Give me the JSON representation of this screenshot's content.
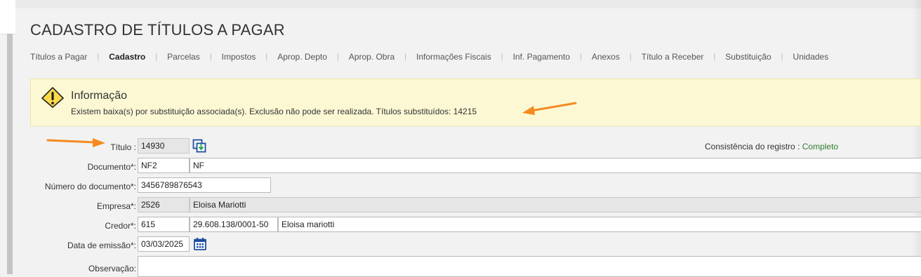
{
  "page": {
    "title": "CADASTRO DE TÍTULOS A PAGAR"
  },
  "tabs": [
    {
      "label": "Títulos a Pagar",
      "active": false
    },
    {
      "label": "Cadastro",
      "active": true
    },
    {
      "label": "Parcelas",
      "active": false
    },
    {
      "label": "Impostos",
      "active": false
    },
    {
      "label": "Aprop. Depto",
      "active": false
    },
    {
      "label": "Aprop. Obra",
      "active": false
    },
    {
      "label": "Informações Fiscais",
      "active": false
    },
    {
      "label": "Inf. Pagamento",
      "active": false
    },
    {
      "label": "Anexos",
      "active": false
    },
    {
      "label": "Título a Receber",
      "active": false
    },
    {
      "label": "Substituição",
      "active": false
    },
    {
      "label": "Unidades",
      "active": false
    }
  ],
  "tab_separator": "|",
  "info": {
    "title": "Informação",
    "message": "Existem baixa(s) por substituição associada(s). Exclusão não pode ser realizada. Títulos substituídos: 14215",
    "icon": "warning-icon"
  },
  "annotation_color": "#f58a1f",
  "form": {
    "titulo": {
      "label": "Título :",
      "value": "14930"
    },
    "consistencia": {
      "label": "Consistência do registro :",
      "value": "Completo"
    },
    "documento": {
      "label": "Documento*:",
      "code": "NF2",
      "description": "NF"
    },
    "numero_documento": {
      "label": "Número do documento*:",
      "value": "3456789876543"
    },
    "empresa": {
      "label": "Empresa*:",
      "code": "2526",
      "name": "Eloisa Mariotti"
    },
    "credor": {
      "label": "Credor*:",
      "code": "615",
      "cnpj": "29.608.138/0001-50",
      "name": "Eloisa mariotti"
    },
    "data_emissao": {
      "label": "Data de emissão*:",
      "value": "03/03/2025"
    },
    "observacao": {
      "label": "Observação:",
      "value": ""
    }
  },
  "colors": {
    "accent_green": "#2e7d32",
    "info_bg": "#fcf8d4",
    "icon_blue": "#1f4e9e"
  }
}
